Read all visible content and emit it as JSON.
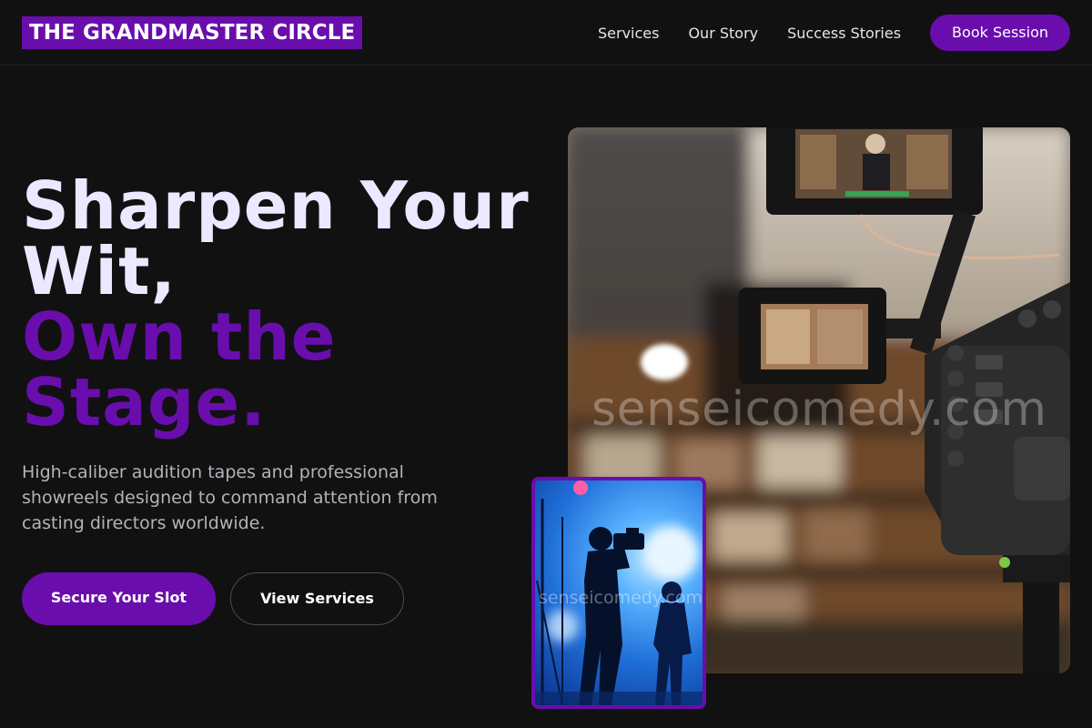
{
  "header": {
    "logo": "THE GRANDMASTER CIRCLE",
    "nav": [
      {
        "label": "Services"
      },
      {
        "label": "Our Story"
      },
      {
        "label": "Success Stories"
      }
    ],
    "cta": "Book Session"
  },
  "hero": {
    "title_line_1": "Sharpen Your",
    "title_line_2": "Wit,",
    "accent_line_1": "Own the",
    "accent_line_2": "Stage.",
    "subtitle": "High-caliber audition tapes and professional showreels designed to command attention from casting directors worldwide.",
    "primary_button": "Secure Your Slot",
    "secondary_button": "View Services"
  },
  "images": {
    "main_watermark": "senseicomedy.com",
    "inset_watermark": "senseicomedy.com"
  },
  "colors": {
    "accent": "#6a0dad",
    "background": "#111112",
    "title_light": "#ece8ff",
    "subtitle": "#b3b3ba"
  }
}
